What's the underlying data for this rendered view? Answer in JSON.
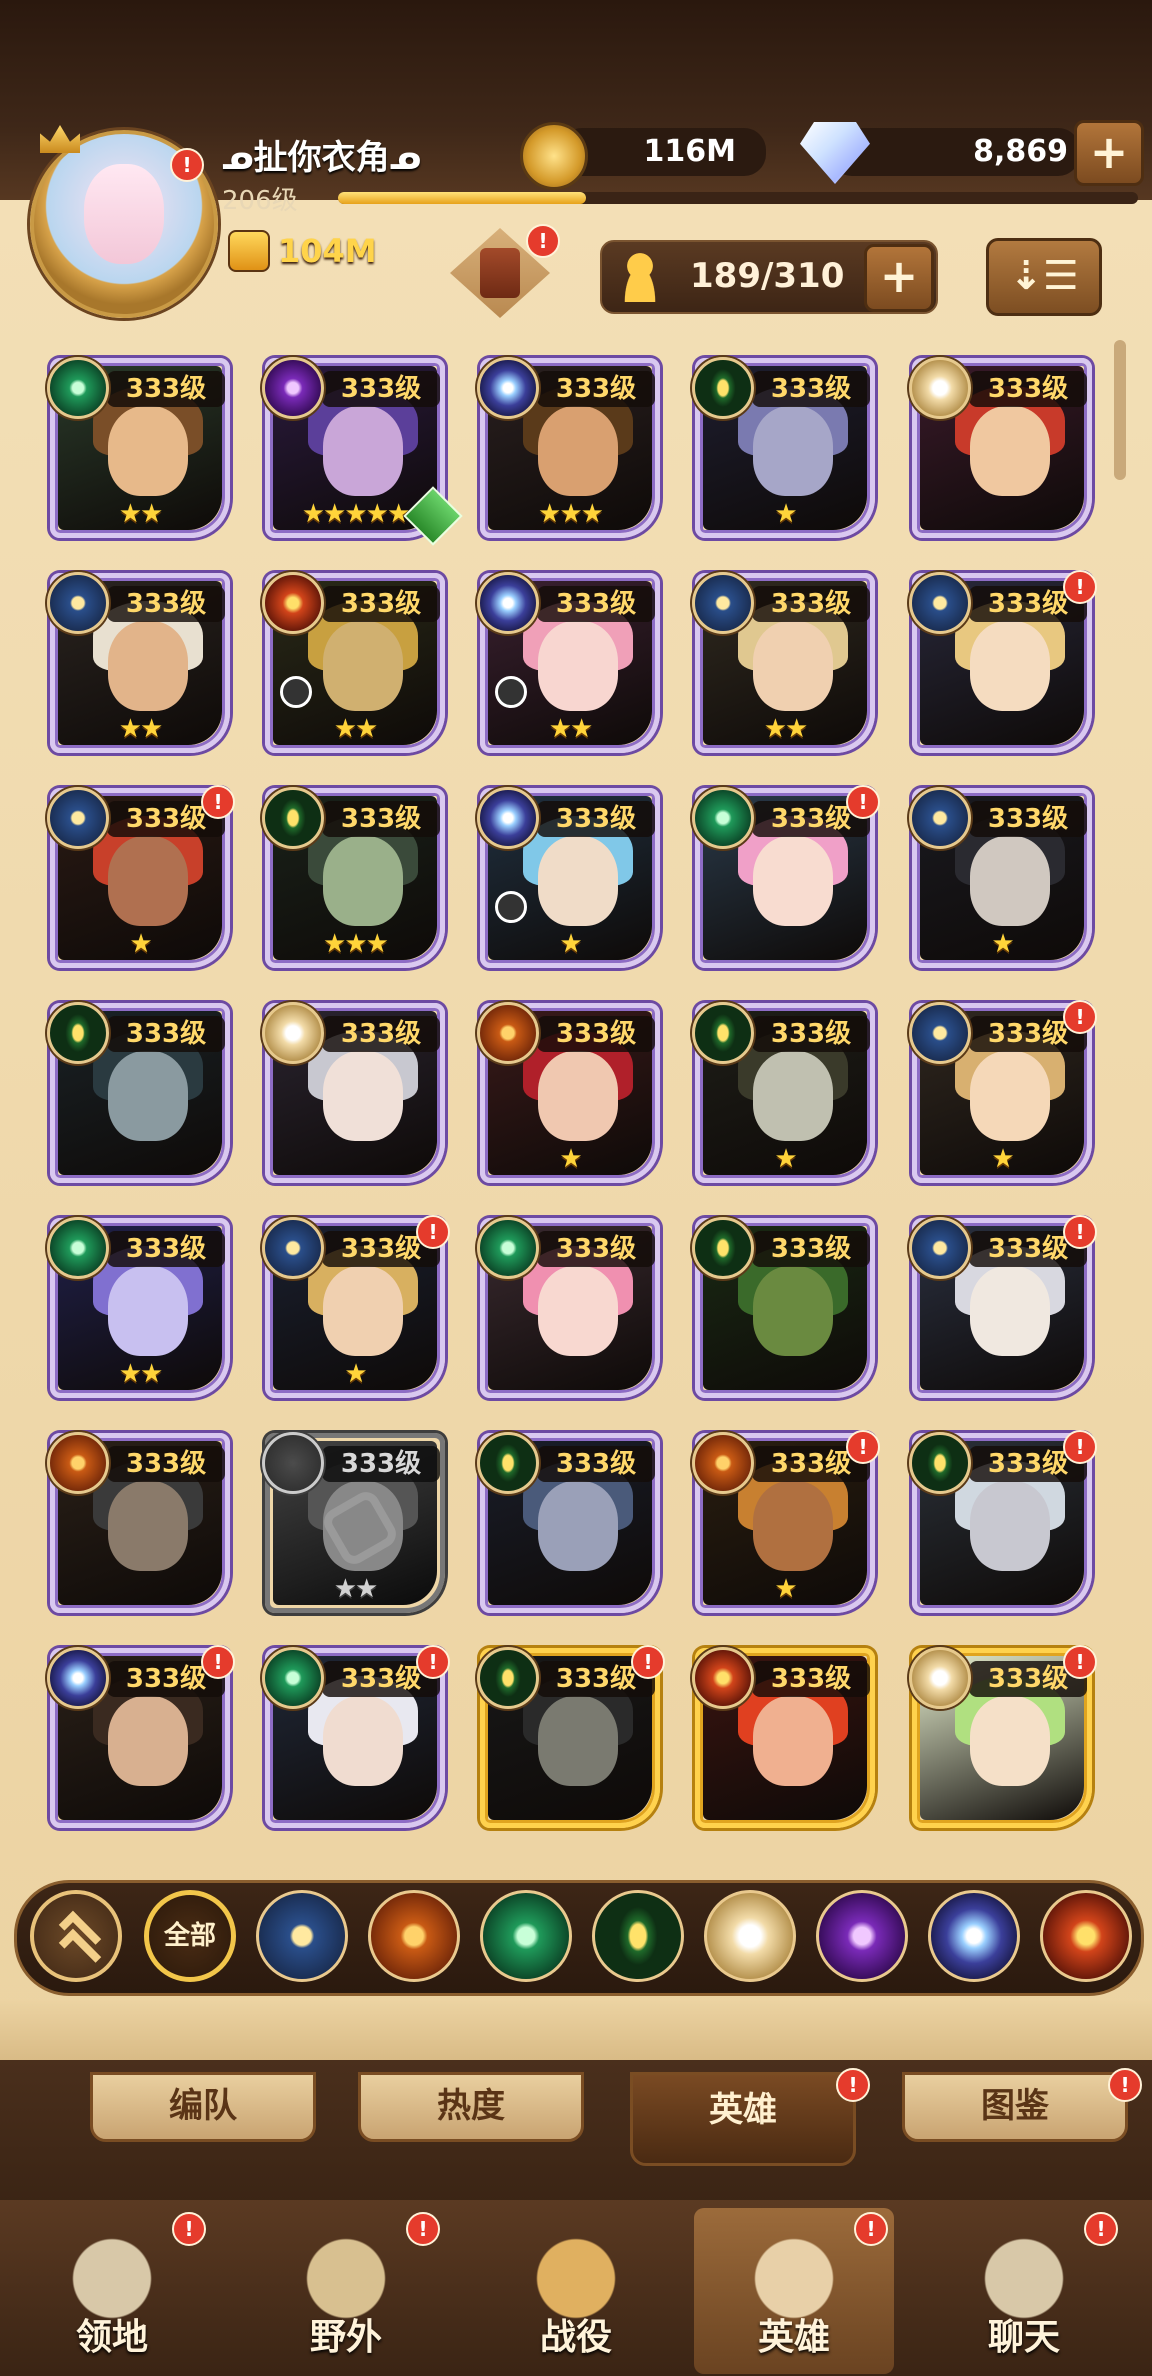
{
  "player": {
    "name": "ᓄ扯你衣角ᓄ",
    "level": "206级",
    "xp_fraction": 0.31,
    "power": "104M"
  },
  "currency": {
    "gold": "116M",
    "diamonds": "8,869"
  },
  "roster": {
    "capacity": "189/310"
  },
  "heroes": [
    {
      "level": "333级",
      "faction": "wilder",
      "stars": "★★",
      "hair": "#7a4e28",
      "skin": "#e7b98a",
      "bg": "#2a3a2a",
      "frame": "purple",
      "dot": false
    },
    {
      "level": "333级",
      "faction": "hypogean",
      "stars": "★★★★★",
      "hair": "#5b3f9a",
      "skin": "#c9a6d8",
      "bg": "#2a1a3e",
      "frame": "purple",
      "dot": false,
      "badge": true
    },
    {
      "level": "333级",
      "faction": "dimensional",
      "stars": "★★★",
      "hair": "#5a3a1a",
      "skin": "#d9a070",
      "bg": "#2a2020",
      "frame": "purple",
      "dot": false
    },
    {
      "level": "333级",
      "faction": "graveborn",
      "stars": "★",
      "hair": "#7a7ab0",
      "skin": "#a6a6c8",
      "bg": "#1e1e30",
      "frame": "purple",
      "dot": false
    },
    {
      "level": "333级",
      "faction": "celestial",
      "stars": "",
      "hair": "#c83a2a",
      "skin": "#f0c8a0",
      "bg": "#3a1a2a",
      "frame": "purple",
      "dot": false
    },
    {
      "level": "333级",
      "faction": "lightbearer",
      "stars": "★★",
      "hair": "#e8e0d0",
      "skin": "#e2b48a",
      "bg": "#2a2420",
      "frame": "purple",
      "dot": false
    },
    {
      "level": "333级",
      "faction": "fire",
      "stars": "★★",
      "hair": "#c8a040",
      "skin": "#d0b070",
      "bg": "#2a2a18",
      "frame": "purple",
      "dot": false,
      "timer": true
    },
    {
      "level": "333级",
      "faction": "dimensional",
      "stars": "★★",
      "hair": "#f0a0b8",
      "skin": "#f8d6d0",
      "bg": "#3a2030",
      "frame": "purple",
      "dot": false,
      "timer": true
    },
    {
      "level": "333级",
      "faction": "lightbearer",
      "stars": "★★",
      "hair": "#e0c890",
      "skin": "#f0d0b0",
      "bg": "#302a20",
      "frame": "purple",
      "dot": false
    },
    {
      "level": "333级",
      "faction": "lightbearer",
      "stars": "",
      "hair": "#e8c880",
      "skin": "#f5dcc0",
      "bg": "#28283a",
      "frame": "purple",
      "dot": true
    },
    {
      "level": "333级",
      "faction": "lightbearer",
      "stars": "★",
      "hair": "#c8402a",
      "skin": "#b07050",
      "bg": "#2a1a14",
      "frame": "purple",
      "dot": true
    },
    {
      "level": "333级",
      "faction": "graveborn",
      "stars": "★★★",
      "hair": "#3a4a3a",
      "skin": "#9ab08a",
      "bg": "#1a221a",
      "frame": "purple",
      "dot": false
    },
    {
      "level": "333级",
      "faction": "dimensional",
      "stars": "★",
      "hair": "#80c8e8",
      "skin": "#f0dcc8",
      "bg": "#203040",
      "frame": "purple",
      "dot": false,
      "timer": true
    },
    {
      "level": "333级",
      "faction": "wilder",
      "stars": "",
      "hair": "#f0a0c8",
      "skin": "#f8dcd0",
      "bg": "#2a3a4a",
      "frame": "purple",
      "dot": true
    },
    {
      "level": "333级",
      "faction": "lightbearer",
      "stars": "★",
      "hair": "#2a2a30",
      "skin": "#d0c8c0",
      "bg": "#1a1a20",
      "frame": "purple",
      "dot": false
    },
    {
      "level": "333级",
      "faction": "graveborn",
      "stars": "",
      "hair": "#2a3a40",
      "skin": "#8a9aa0",
      "bg": "#1a2226",
      "frame": "purple",
      "dot": false
    },
    {
      "level": "333级",
      "faction": "celestial",
      "stars": "",
      "hair": "#c8c8d0",
      "skin": "#f0e0d8",
      "bg": "#2a2430",
      "frame": "purple",
      "dot": false
    },
    {
      "level": "333级",
      "faction": "mauler",
      "stars": "★",
      "hair": "#b0202a",
      "skin": "#f0c8b0",
      "bg": "#3a1a1a",
      "frame": "purple",
      "dot": false
    },
    {
      "level": "333级",
      "faction": "graveborn",
      "stars": "★",
      "hair": "#3a3a2a",
      "skin": "#c0c0b0",
      "bg": "#1e1e18",
      "frame": "purple",
      "dot": false
    },
    {
      "level": "333级",
      "faction": "lightbearer",
      "stars": "★",
      "hair": "#d8b070",
      "skin": "#f5d8b8",
      "bg": "#302820",
      "frame": "purple",
      "dot": true
    },
    {
      "level": "333级",
      "faction": "wilder",
      "stars": "★★",
      "hair": "#8070d0",
      "skin": "#c8c0f0",
      "bg": "#20204a",
      "frame": "purple",
      "dot": false
    },
    {
      "level": "333级",
      "faction": "lightbearer",
      "stars": "★",
      "hair": "#d8b060",
      "skin": "#f0d0b0",
      "bg": "#1a2030",
      "frame": "purple",
      "dot": true
    },
    {
      "level": "333级",
      "faction": "wilder",
      "stars": "",
      "hair": "#f090b0",
      "skin": "#f8d8d0",
      "bg": "#3a2a30",
      "frame": "purple",
      "dot": false
    },
    {
      "level": "333级",
      "faction": "graveborn",
      "stars": "",
      "hair": "#3a6a2a",
      "skin": "#6a8a40",
      "bg": "#1a2a14",
      "frame": "purple",
      "dot": false
    },
    {
      "level": "333级",
      "faction": "lightbearer",
      "stars": "",
      "hair": "#d8d8e0",
      "skin": "#f0e8e0",
      "bg": "#2a3040",
      "frame": "purple",
      "dot": true
    },
    {
      "level": "333级",
      "faction": "mauler",
      "stars": "",
      "hair": "#3a3a3a",
      "skin": "#8a7a6a",
      "bg": "#2a2018",
      "frame": "purple",
      "dot": false
    },
    {
      "level": "333级",
      "faction": "locked",
      "stars": "★★",
      "hair": "#555555",
      "skin": "#888888",
      "bg": "#444444",
      "frame": "gray",
      "dot": false,
      "locked": true
    },
    {
      "level": "333级",
      "faction": "graveborn",
      "stars": "",
      "hair": "#4a5a7a",
      "skin": "#9aa0b8",
      "bg": "#1a1e2a",
      "frame": "purple",
      "dot": false
    },
    {
      "level": "333级",
      "faction": "mauler",
      "stars": "★",
      "hair": "#c88030",
      "skin": "#b07040",
      "bg": "#2a1e10",
      "frame": "purple",
      "dot": true
    },
    {
      "level": "333级",
      "faction": "graveborn",
      "stars": "",
      "hair": "#d0d8e0",
      "skin": "#c8c8d0",
      "bg": "#2a3038",
      "frame": "purple",
      "dot": true
    },
    {
      "level": "333级",
      "faction": "dimensional",
      "stars": "",
      "hair": "#3a2a20",
      "skin": "#d8b090",
      "bg": "#2a2018",
      "frame": "purple",
      "dot": true
    },
    {
      "level": "333级",
      "faction": "wilder",
      "stars": "",
      "hair": "#e8e8f0",
      "skin": "#f0dcd0",
      "bg": "#202838",
      "frame": "purple",
      "dot": true
    },
    {
      "level": "333级",
      "faction": "graveborn",
      "stars": "",
      "hair": "#2a2a2a",
      "skin": "#7a7a70",
      "bg": "#181818",
      "frame": "gold",
      "dot": true
    },
    {
      "level": "333级",
      "faction": "fire",
      "stars": "",
      "hair": "#e04020",
      "skin": "#f0b090",
      "bg": "#3a1410",
      "frame": "gold",
      "dot": false
    },
    {
      "level": "333级",
      "faction": "celestial",
      "stars": "",
      "hair": "#b0e080",
      "skin": "#f5e0c8",
      "bg": "#e8f0d0",
      "frame": "gold",
      "dot": true
    }
  ],
  "faction_filter": {
    "all_label": "全部",
    "items": [
      "lightbearer",
      "mauler",
      "wilder",
      "graveborn",
      "celestial",
      "hypogean",
      "dimensional",
      "fire"
    ]
  },
  "subtabs": [
    {
      "label": "编队",
      "active": false,
      "dot": false
    },
    {
      "label": "热度",
      "active": false,
      "dot": false
    },
    {
      "label": "英雄",
      "active": true,
      "dot": true
    },
    {
      "label": "图鉴",
      "active": false,
      "dot": true
    }
  ],
  "nav": [
    {
      "label": "领地",
      "icon": "castle-icon",
      "active": false,
      "dot": true
    },
    {
      "label": "野外",
      "icon": "map-scroll-icon",
      "active": false,
      "dot": true
    },
    {
      "label": "战役",
      "icon": "sword-icon",
      "active": false,
      "dot": false
    },
    {
      "label": "英雄",
      "icon": "helmet-icon",
      "active": true,
      "dot": true
    },
    {
      "label": "聊天",
      "icon": "chat-icon",
      "active": false,
      "dot": true
    }
  ],
  "colors": {
    "accent": "#ffd44a",
    "frame_purple": "#8d6cc5",
    "frame_gold": "#e0a41f",
    "red_dot": "#e53b2c"
  }
}
